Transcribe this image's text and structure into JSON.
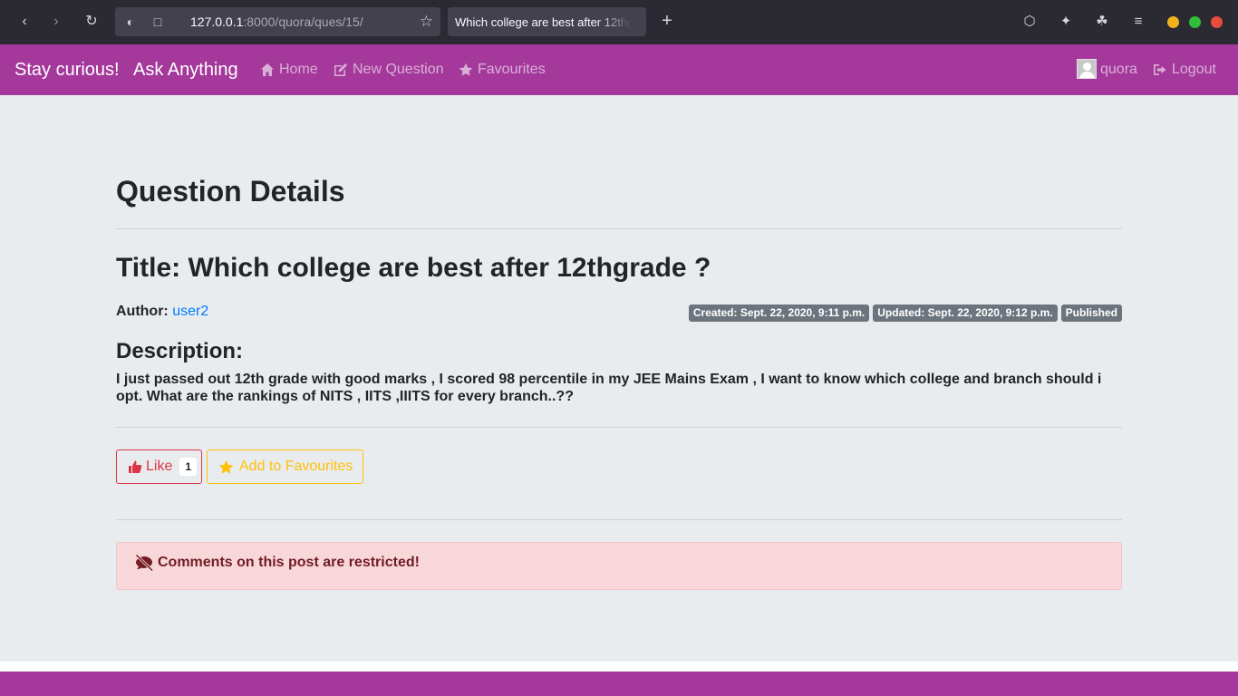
{
  "browser": {
    "url_host": "127.0.0.1",
    "url_path": ":8000/quora/ques/15/",
    "tab_title": "Which college are best after 12thgrade ?",
    "window_controls": [
      "#f0b21b",
      "#2fbf3b",
      "#e74c3c"
    ]
  },
  "navbar": {
    "brand": "Stay curious!",
    "tagline": "Ask Anything",
    "links": [
      {
        "label": "Home",
        "icon": "home-icon"
      },
      {
        "label": "New Question",
        "icon": "edit-icon"
      },
      {
        "label": "Favourites",
        "icon": "star-icon"
      }
    ],
    "user": "quora",
    "logout": "Logout",
    "color": "#a4389b"
  },
  "page": {
    "heading": "Question Details",
    "title": "Title: Which college are best after 12thgrade ?",
    "author_label": "Author:",
    "author_name": "user2",
    "badges": {
      "created": "Created: Sept. 22, 2020, 9:11 p.m.",
      "updated": "Updated: Sept. 22, 2020, 9:12 p.m.",
      "status": "Published"
    },
    "description_heading": "Description:",
    "description": "I just passed out 12th grade with good marks , I scored 98 percentile in my JEE Mains Exam , I want to know which college and branch should i opt. What are the rankings of NITS , IITS ,IIITS for every branch..??"
  },
  "actions": {
    "like_label": "Like",
    "like_count": "1",
    "favourite_label": "Add to Favourites"
  },
  "alert": {
    "message": "Comments on this post are restricted!"
  }
}
